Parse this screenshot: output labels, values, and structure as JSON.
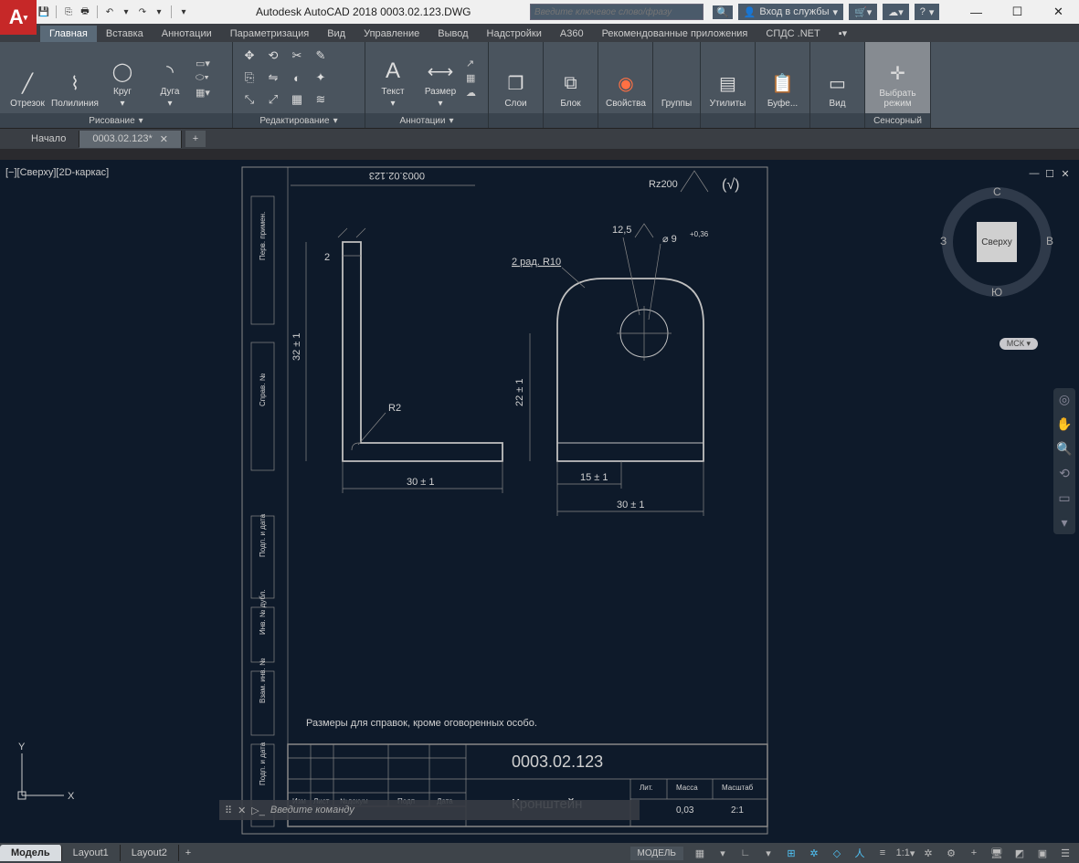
{
  "app": {
    "title": "Autodesk AutoCAD 2018    0003.02.123.DWG",
    "logo": "A",
    "search_placeholder": "Введите ключевое слово/фразу",
    "signin": "Вход в службы",
    "help_icon": "?"
  },
  "ribbon_tabs": [
    "Главная",
    "Вставка",
    "Аннотации",
    "Параметризация",
    "Вид",
    "Управление",
    "Вывод",
    "Надстройки",
    "A360",
    "Рекомендованные приложения",
    "СПДС .NET"
  ],
  "ribbon": {
    "draw": {
      "label": "Рисование",
      "items": [
        "Отрезок",
        "Полилиния",
        "Круг",
        "Дуга"
      ]
    },
    "edit": {
      "label": "Редактирование"
    },
    "anno": {
      "label": "Аннотации",
      "items": [
        "Текст",
        "Размер"
      ]
    },
    "layers": {
      "label": "Слои"
    },
    "block": {
      "label": "Блок"
    },
    "props": {
      "label": "Свойства"
    },
    "groups": {
      "label": "Группы"
    },
    "utils": {
      "label": "Утилиты"
    },
    "clip": {
      "label": "Буфе..."
    },
    "view": {
      "label": "Вид"
    },
    "select": {
      "label": "Выбрать режим",
      "panel": "Сенсорный"
    }
  },
  "file_tabs": {
    "start": "Начало",
    "doc": "0003.02.123*"
  },
  "viewport": {
    "label": "[−][Сверху][2D-каркас]",
    "cube_face": "Сверху",
    "dir_n": "С",
    "dir_s": "Ю",
    "dir_e": "В",
    "dir_w": "З",
    "wcs": "МСК"
  },
  "cmd": {
    "placeholder": "Введите команду"
  },
  "layout_tabs": [
    "Модель",
    "Layout1",
    "Layout2"
  ],
  "status": {
    "model": "МОДЕЛЬ",
    "scale": "1:1"
  },
  "drawing": {
    "number": "0003.02.123",
    "number_mirror": "0003.02.123",
    "title": "Кронштейн",
    "note": "Размеры для справок, кроме оговоренных особо.",
    "surface": "Rz200",
    "dims": {
      "d1": "2",
      "d2": "32 ± 1",
      "d3": "R2",
      "d4": "30 ± 1",
      "d5": "12,5",
      "d6": "⌀ 9",
      "d6t": "+0,36",
      "d7": "2 рад. R10",
      "d8": "22 ± 1",
      "d9": "15 ± 1",
      "d10": "30 ± 1"
    },
    "titleblock": {
      "h_izm": "Изм",
      "h_list": "Лист",
      "h_ndok": "№докум",
      "h_podp": "Подп",
      "h_data": "Дата",
      "h_lit": "Лит.",
      "h_mass": "Масса",
      "h_scale": "Масштаб",
      "mass": "0,03",
      "scale": "2:1",
      "side_labels": [
        "Перв. примен.",
        "Справ. №",
        "Подп. и дата",
        "Инв. № дубл.",
        "Взам. инв. №",
        "Подп. и дата"
      ]
    }
  }
}
